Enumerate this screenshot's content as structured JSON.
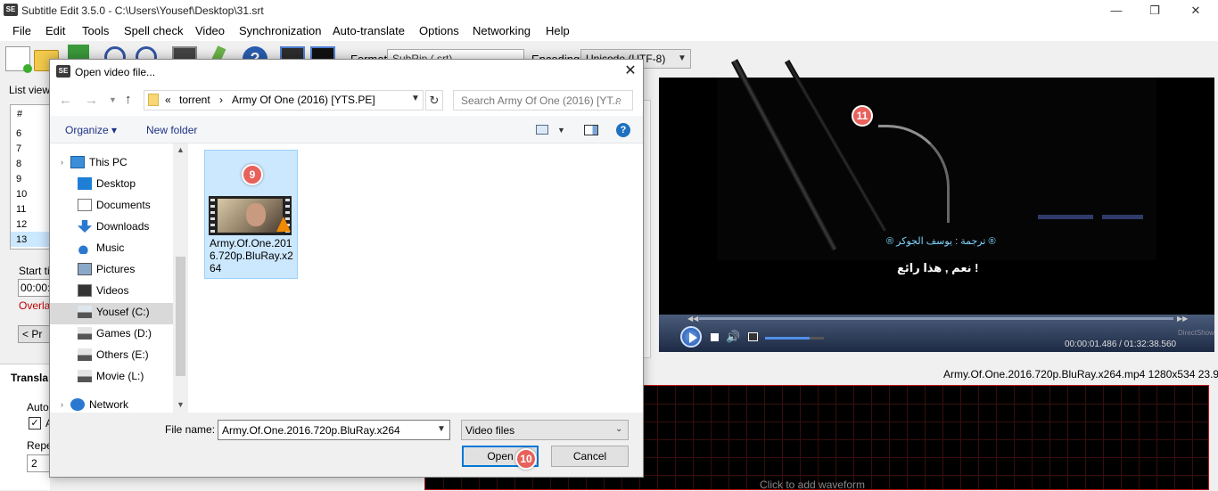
{
  "window": {
    "title": "Subtitle Edit 3.5.0 - C:\\Users\\Yousef\\Desktop\\31.srt",
    "app_icon_text": "SE",
    "min_glyph": "—",
    "restore_glyph": "❐",
    "close_glyph": "✕"
  },
  "menu": [
    "File",
    "Edit",
    "Tools",
    "Spell check",
    "Video",
    "Synchronization",
    "Auto-translate",
    "Options",
    "Networking",
    "Help"
  ],
  "toolbar": {
    "format_label": "Format",
    "format_value": "SubRip (.srt)",
    "encoding_label": "Encoding",
    "encoding_value": "Unicode (UTF-8)",
    "help_glyph": "?"
  },
  "main": {
    "list_view_label": "List view",
    "list_header": "#",
    "rows": [
      "6",
      "7",
      "8",
      "9",
      "10",
      "11",
      "12",
      "13"
    ],
    "start_time_label": "Start ti",
    "start_time_value": "00:00:",
    "overlap_label": "Overla",
    "prev_button": "< Pr",
    "translate_label": "Transla",
    "auto_label": "Auto",
    "auto_checkbox_label": "A",
    "repeat_label": "Repe",
    "repeat_value": "2"
  },
  "video": {
    "subtitle_small": "® ترجمة : يوسف الجوكر ®",
    "subtitle_main": "! نعم , هذا رائع",
    "engine_label": "DirectShow",
    "time_readout": "00:00:01.486 / 01:32:38.560",
    "file_info": "Army.Of.One.2016.720p.BluRay.x264.mp4 1280x534  23.976",
    "waveform_hint": "Click to add waveform",
    "progress": 0.0003,
    "volume": 0.75
  },
  "dialog": {
    "title": "Open video file...",
    "icon_text": "SE",
    "breadcrumb": [
      "«",
      "torrent",
      "›",
      "Army Of One (2016) [YTS.PE]"
    ],
    "search_placeholder": "Search Army Of One (2016) [YT...",
    "organize_label": "Organize ▾",
    "new_folder_label": "New folder",
    "help_glyph": "?",
    "nav_items": [
      {
        "label": "This PC",
        "icon": "computer-icon"
      },
      {
        "label": "Desktop",
        "icon": "desktop-icon"
      },
      {
        "label": "Documents",
        "icon": "documents-icon"
      },
      {
        "label": "Downloads",
        "icon": "downloads-icon"
      },
      {
        "label": "Music",
        "icon": "music-icon"
      },
      {
        "label": "Pictures",
        "icon": "pictures-icon"
      },
      {
        "label": "Videos",
        "icon": "videos-icon"
      },
      {
        "label": "Yousef (C:)",
        "icon": "drive-c-icon",
        "selected": true
      },
      {
        "label": "Games (D:)",
        "icon": "drive-icon"
      },
      {
        "label": "Others (E:)",
        "icon": "drive-icon"
      },
      {
        "label": "Movie (L:)",
        "icon": "drive-icon"
      },
      {
        "label": "Network",
        "icon": "network-icon"
      }
    ],
    "file": {
      "name": "Army.Of.One.2016.720p.BluRay.x264"
    },
    "filename_label": "File name:",
    "filename_value": "Army.Of.One.2016.720p.BluRay.x264",
    "filetype_value": "Video files",
    "open_button": "Open",
    "cancel_button": "Cancel"
  },
  "badges": {
    "b9": "9",
    "b10": "10",
    "b11": "11"
  },
  "colors": {
    "accent": "#0078d7",
    "badge": "#e8615b",
    "selection": "#cce8ff",
    "overlap_red": "#c00000"
  }
}
